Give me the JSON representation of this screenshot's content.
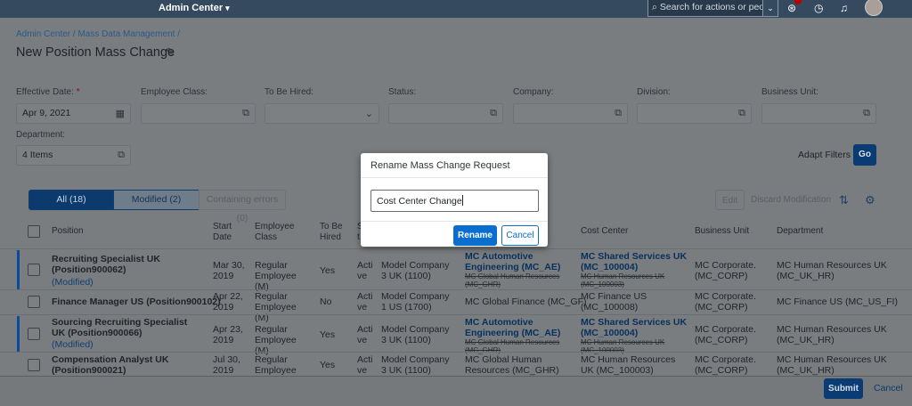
{
  "topbar": {
    "title": "Admin Center",
    "search_placeholder": "Search for actions or peo...",
    "icons": [
      "chevron-down-icon",
      "notification-icon",
      "chat-icon",
      "bell-icon",
      "avatar"
    ]
  },
  "breadcrumb": "Admin Center / Mass Data Management /",
  "page_title": "New Position Mass Change",
  "filters": {
    "effective_date": {
      "label": "Effective Date:",
      "required": "*",
      "value": "Apr 9, 2021"
    },
    "employee_class": {
      "label": "Employee Class:"
    },
    "to_be_hired": {
      "label": "To Be Hired:"
    },
    "status": {
      "label": "Status:"
    },
    "company": {
      "label": "Company:"
    },
    "division": {
      "label": "Division:"
    },
    "business_unit": {
      "label": "Business Unit:"
    },
    "department": {
      "label": "Department:",
      "value": "4 Items"
    },
    "adapt_filters": "Adapt Filters",
    "go": "Go"
  },
  "tabs": [
    {
      "label": "All (18)"
    },
    {
      "label": "Modified (2)"
    },
    {
      "label": "Containing errors (0)"
    }
  ],
  "toolbar": {
    "edit": "Edit",
    "discard": "Discard Modification"
  },
  "columns": {
    "position": "Position",
    "start_date": "Start Date",
    "employee_class": "Employee Class",
    "to_be_hired": "To Be Hired",
    "status": "S t",
    "company": "",
    "cost_center": "Cost Center",
    "business_unit": "Business Unit",
    "department": "Department"
  },
  "rows": [
    {
      "position": "Recruiting Specialist UK (Position900062)",
      "modified": "(Modified)",
      "start": "Mar 30, 2019",
      "class": "Regular Employee (M)",
      "hired": "Yes",
      "status": "Acti ve",
      "company": "Model Company 3 UK (1100)",
      "division": "MC Automotive Engineering (MC_AE)",
      "division_old": "MC Global Human Resources (MC_GHR)",
      "cost": "MC Shared Services UK (MC_100004)",
      "cost_old": "MC Human Resources UK (MC_100003)",
      "bu": "MC Corporate. (MC_CORP)",
      "dept": "MC Human Resources UK (MC_UK_HR)"
    },
    {
      "position": "Finance Manager US (Position900102)",
      "modified": "",
      "start": "Apr 22, 2019",
      "class": "Regular Employee (M)",
      "hired": "No",
      "status": "Acti ve",
      "company": "Model Company 1 US (1700)",
      "division": "MC Global Finance (MC_GF)",
      "division_old": "",
      "cost": "MC Finance US (MC_100008)",
      "cost_old": "",
      "bu": "MC Corporate. (MC_CORP)",
      "dept": "MC Finance US (MC_US_FI)"
    },
    {
      "position": "Sourcing Recruiting Specialist UK (Position900066)",
      "modified": "(Modified)",
      "start": "Apr 23, 2019",
      "class": "Regular Employee (M)",
      "hired": "Yes",
      "status": "Acti ve",
      "company": "Model Company 3 UK (1100)",
      "division": "MC Automotive Engineering (MC_AE)",
      "division_old": "MC Global Human Resources (MC_GHR)",
      "cost": "MC Shared Services UK (MC_100004)",
      "cost_old": "MC Human Resources UK (MC_100003)",
      "bu": "MC Corporate. (MC_CORP)",
      "dept": "MC Human Resources UK (MC_UK_HR)"
    },
    {
      "position": "Compensation Analyst UK (Position900021)",
      "modified": "",
      "start": "Jul 30, 2019",
      "class": "Regular Employee (M)",
      "hired": "Yes",
      "status": "Acti ve",
      "company": "Model Company 3 UK (1100)",
      "division": "MC Global Human Resources (MC_GHR)",
      "division_old": "",
      "cost": "MC Human Resources UK (MC_100003)",
      "cost_old": "",
      "bu": "MC Corporate. (MC_CORP)",
      "dept": "MC Human Resources UK (MC_UK_HR)"
    }
  ],
  "footer": {
    "submit": "Submit",
    "cancel": "Cancel"
  },
  "dialog": {
    "title": "Rename Mass Change Request",
    "input_value": "Cost Center Change",
    "rename": "Rename",
    "cancel": "Cancel"
  }
}
